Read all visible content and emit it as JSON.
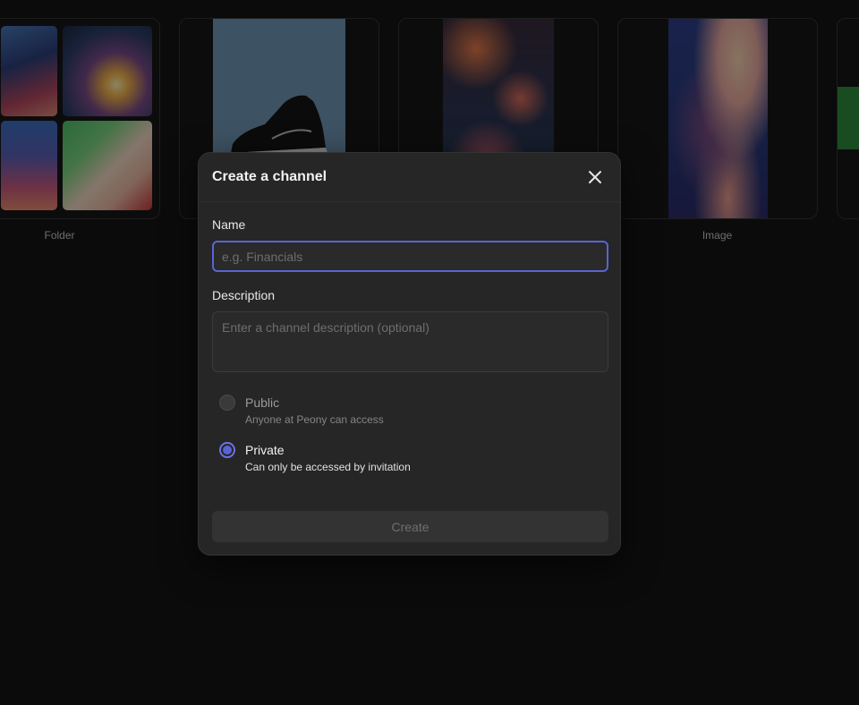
{
  "gallery": {
    "cards": [
      {
        "label": "Folder",
        "kind": "folder"
      },
      {
        "label": "",
        "kind": "product"
      },
      {
        "label": "",
        "kind": "ocean"
      },
      {
        "label": "Image",
        "kind": "clouds"
      },
      {
        "label": "",
        "kind": "partial"
      }
    ]
  },
  "modal": {
    "title": "Create a channel",
    "name_label": "Name",
    "name_placeholder": "e.g. Financials",
    "name_value": "",
    "description_label": "Description",
    "description_placeholder": "Enter a channel description (optional)",
    "visibility": {
      "selected": "private",
      "options": [
        {
          "id": "public",
          "title": "Public",
          "subtitle": "Anyone at Peony can access"
        },
        {
          "id": "private",
          "title": "Private",
          "subtitle": "Can only be accessed by invitation"
        }
      ]
    },
    "create_label": "Create"
  },
  "colors": {
    "accent": "#5b63d3",
    "modal_bg": "#262626",
    "backdrop": "#0b0b0b"
  },
  "icons": {
    "close": "close-icon",
    "radio_selected": "radio-selected-icon",
    "radio_unselected": "radio-unselected-icon"
  }
}
